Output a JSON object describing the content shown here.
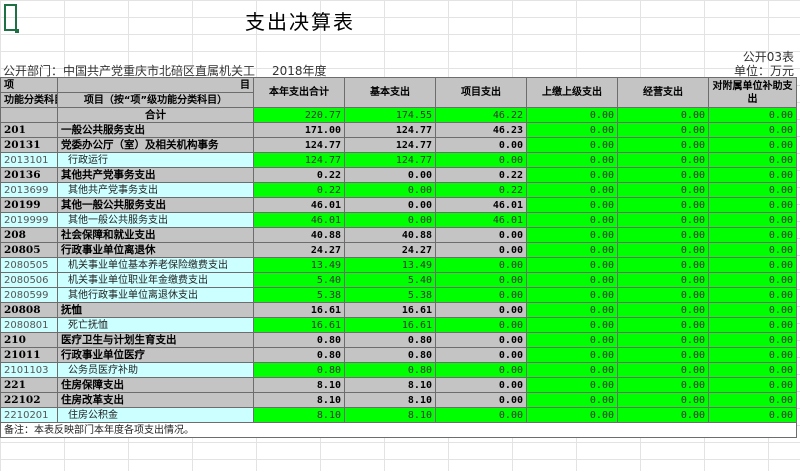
{
  "title": "支出决算表",
  "form_code": "公开03表",
  "department_label": "公开部门：中国共产党重庆市北碚区直属机关工",
  "year": "2018年度",
  "unit": "单位：万元",
  "header": {
    "item_label": "项",
    "mu_label": "目",
    "col_code": "功能分类科目编码",
    "col_name": "项目（按“项”级功能分类科目）",
    "cols": [
      "本年支出合计",
      "基本支出",
      "项目支出",
      "上缴上级支出",
      "经营支出",
      "对附属单位补助支出"
    ]
  },
  "rows": [
    {
      "type": "total",
      "code": "",
      "name": "合计",
      "values": [
        "220.77",
        "174.55",
        "46.22",
        "0.00",
        "0.00",
        "0.00"
      ],
      "green": [
        1,
        1,
        1,
        1,
        1,
        1
      ]
    },
    {
      "type": "grey",
      "code": "201",
      "name": "一般公共服务支出",
      "values": [
        "171.00",
        "124.77",
        "46.23",
        "0.00",
        "0.00",
        "0.00"
      ],
      "green": [
        0,
        0,
        0,
        1,
        1,
        1
      ]
    },
    {
      "type": "grey",
      "code": "20131",
      "name": "党委办公厅（室）及相关机构事务",
      "values": [
        "124.77",
        "124.77",
        "0.00",
        "0.00",
        "0.00",
        "0.00"
      ],
      "green": [
        0,
        0,
        0,
        1,
        1,
        1
      ]
    },
    {
      "type": "light",
      "code": "2013101",
      "name": "行政运行",
      "values": [
        "124.77",
        "124.77",
        "0.00",
        "0.00",
        "0.00",
        "0.00"
      ],
      "green": [
        1,
        1,
        1,
        1,
        1,
        1
      ]
    },
    {
      "type": "grey",
      "code": "20136",
      "name": "其他共产党事务支出",
      "values": [
        "0.22",
        "0.00",
        "0.22",
        "0.00",
        "0.00",
        "0.00"
      ],
      "green": [
        0,
        0,
        0,
        1,
        1,
        1
      ]
    },
    {
      "type": "light",
      "code": "2013699",
      "name": "其他共产党事务支出",
      "values": [
        "0.22",
        "0.00",
        "0.22",
        "0.00",
        "0.00",
        "0.00"
      ],
      "green": [
        1,
        1,
        1,
        1,
        1,
        1
      ]
    },
    {
      "type": "grey",
      "code": "20199",
      "name": "其他一般公共服务支出",
      "values": [
        "46.01",
        "0.00",
        "46.01",
        "0.00",
        "0.00",
        "0.00"
      ],
      "green": [
        0,
        0,
        0,
        1,
        1,
        1
      ]
    },
    {
      "type": "light",
      "code": "2019999",
      "name": "其他一般公共服务支出",
      "values": [
        "46.01",
        "0.00",
        "46.01",
        "0.00",
        "0.00",
        "0.00"
      ],
      "green": [
        1,
        1,
        1,
        1,
        1,
        1
      ]
    },
    {
      "type": "grey",
      "code": "208",
      "name": "社会保障和就业支出",
      "values": [
        "40.88",
        "40.88",
        "0.00",
        "0.00",
        "0.00",
        "0.00"
      ],
      "green": [
        0,
        0,
        0,
        1,
        1,
        1
      ]
    },
    {
      "type": "grey",
      "code": "20805",
      "name": "行政事业单位离退休",
      "values": [
        "24.27",
        "24.27",
        "0.00",
        "0.00",
        "0.00",
        "0.00"
      ],
      "green": [
        0,
        0,
        0,
        1,
        1,
        1
      ]
    },
    {
      "type": "light",
      "code": "2080505",
      "name": "机关事业单位基本养老保险缴费支出",
      "values": [
        "13.49",
        "13.49",
        "0.00",
        "0.00",
        "0.00",
        "0.00"
      ],
      "green": [
        1,
        1,
        1,
        1,
        1,
        1
      ]
    },
    {
      "type": "light",
      "code": "2080506",
      "name": "机关事业单位职业年金缴费支出",
      "values": [
        "5.40",
        "5.40",
        "0.00",
        "0.00",
        "0.00",
        "0.00"
      ],
      "green": [
        1,
        1,
        1,
        1,
        1,
        1
      ]
    },
    {
      "type": "light",
      "code": "2080599",
      "name": "其他行政事业单位离退休支出",
      "values": [
        "5.38",
        "5.38",
        "0.00",
        "0.00",
        "0.00",
        "0.00"
      ],
      "green": [
        1,
        1,
        1,
        1,
        1,
        1
      ]
    },
    {
      "type": "grey",
      "code": "20808",
      "name": "抚恤",
      "values": [
        "16.61",
        "16.61",
        "0.00",
        "0.00",
        "0.00",
        "0.00"
      ],
      "green": [
        0,
        0,
        0,
        1,
        1,
        1
      ]
    },
    {
      "type": "light",
      "code": "2080801",
      "name": "死亡抚恤",
      "values": [
        "16.61",
        "16.61",
        "0.00",
        "0.00",
        "0.00",
        "0.00"
      ],
      "green": [
        1,
        1,
        1,
        1,
        1,
        1
      ]
    },
    {
      "type": "grey",
      "code": "210",
      "name": "医疗卫生与计划生育支出",
      "values": [
        "0.80",
        "0.80",
        "0.00",
        "0.00",
        "0.00",
        "0.00"
      ],
      "green": [
        0,
        0,
        0,
        1,
        1,
        1
      ]
    },
    {
      "type": "grey",
      "code": "21011",
      "name": "行政事业单位医疗",
      "values": [
        "0.80",
        "0.80",
        "0.00",
        "0.00",
        "0.00",
        "0.00"
      ],
      "green": [
        0,
        0,
        0,
        1,
        1,
        1
      ]
    },
    {
      "type": "light",
      "code": "2101103",
      "name": "公务员医疗补助",
      "values": [
        "0.80",
        "0.80",
        "0.00",
        "0.00",
        "0.00",
        "0.00"
      ],
      "green": [
        1,
        1,
        1,
        1,
        1,
        1
      ]
    },
    {
      "type": "grey",
      "code": "221",
      "name": "住房保障支出",
      "values": [
        "8.10",
        "8.10",
        "0.00",
        "0.00",
        "0.00",
        "0.00"
      ],
      "green": [
        0,
        0,
        0,
        1,
        1,
        1
      ]
    },
    {
      "type": "grey",
      "code": "22102",
      "name": "住房改革支出",
      "values": [
        "8.10",
        "8.10",
        "0.00",
        "0.00",
        "0.00",
        "0.00"
      ],
      "green": [
        0,
        0,
        0,
        1,
        1,
        1
      ]
    },
    {
      "type": "light",
      "code": "2210201",
      "name": "住房公积金",
      "values": [
        "8.10",
        "8.10",
        "0.00",
        "0.00",
        "0.00",
        "0.00"
      ],
      "green": [
        1,
        1,
        1,
        1,
        1,
        1
      ]
    }
  ],
  "note": "备注：本表反映部门本年度各项支出情况。"
}
